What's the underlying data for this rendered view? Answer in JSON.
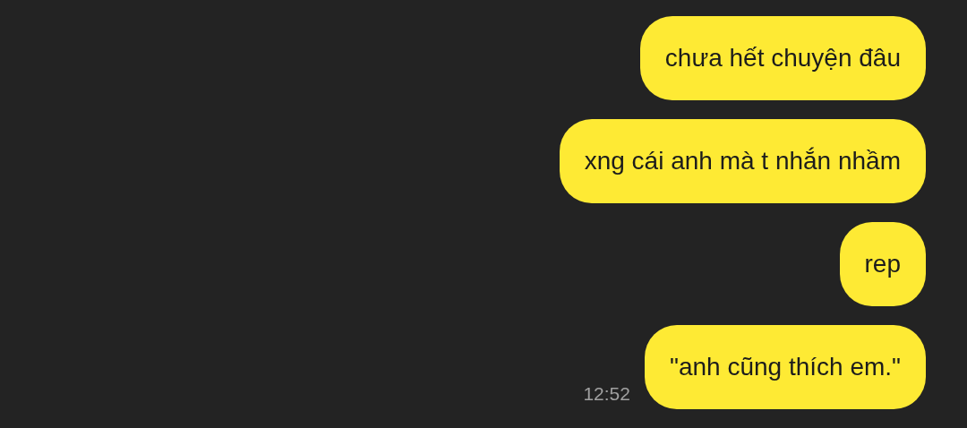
{
  "messages": [
    {
      "text": "chưa hết chuyện đâu"
    },
    {
      "text": "xng cái anh mà t nhắn nhầm"
    },
    {
      "text": "rep"
    },
    {
      "text": "\"anh cũng thích em.\"",
      "time": "12:52"
    }
  ]
}
